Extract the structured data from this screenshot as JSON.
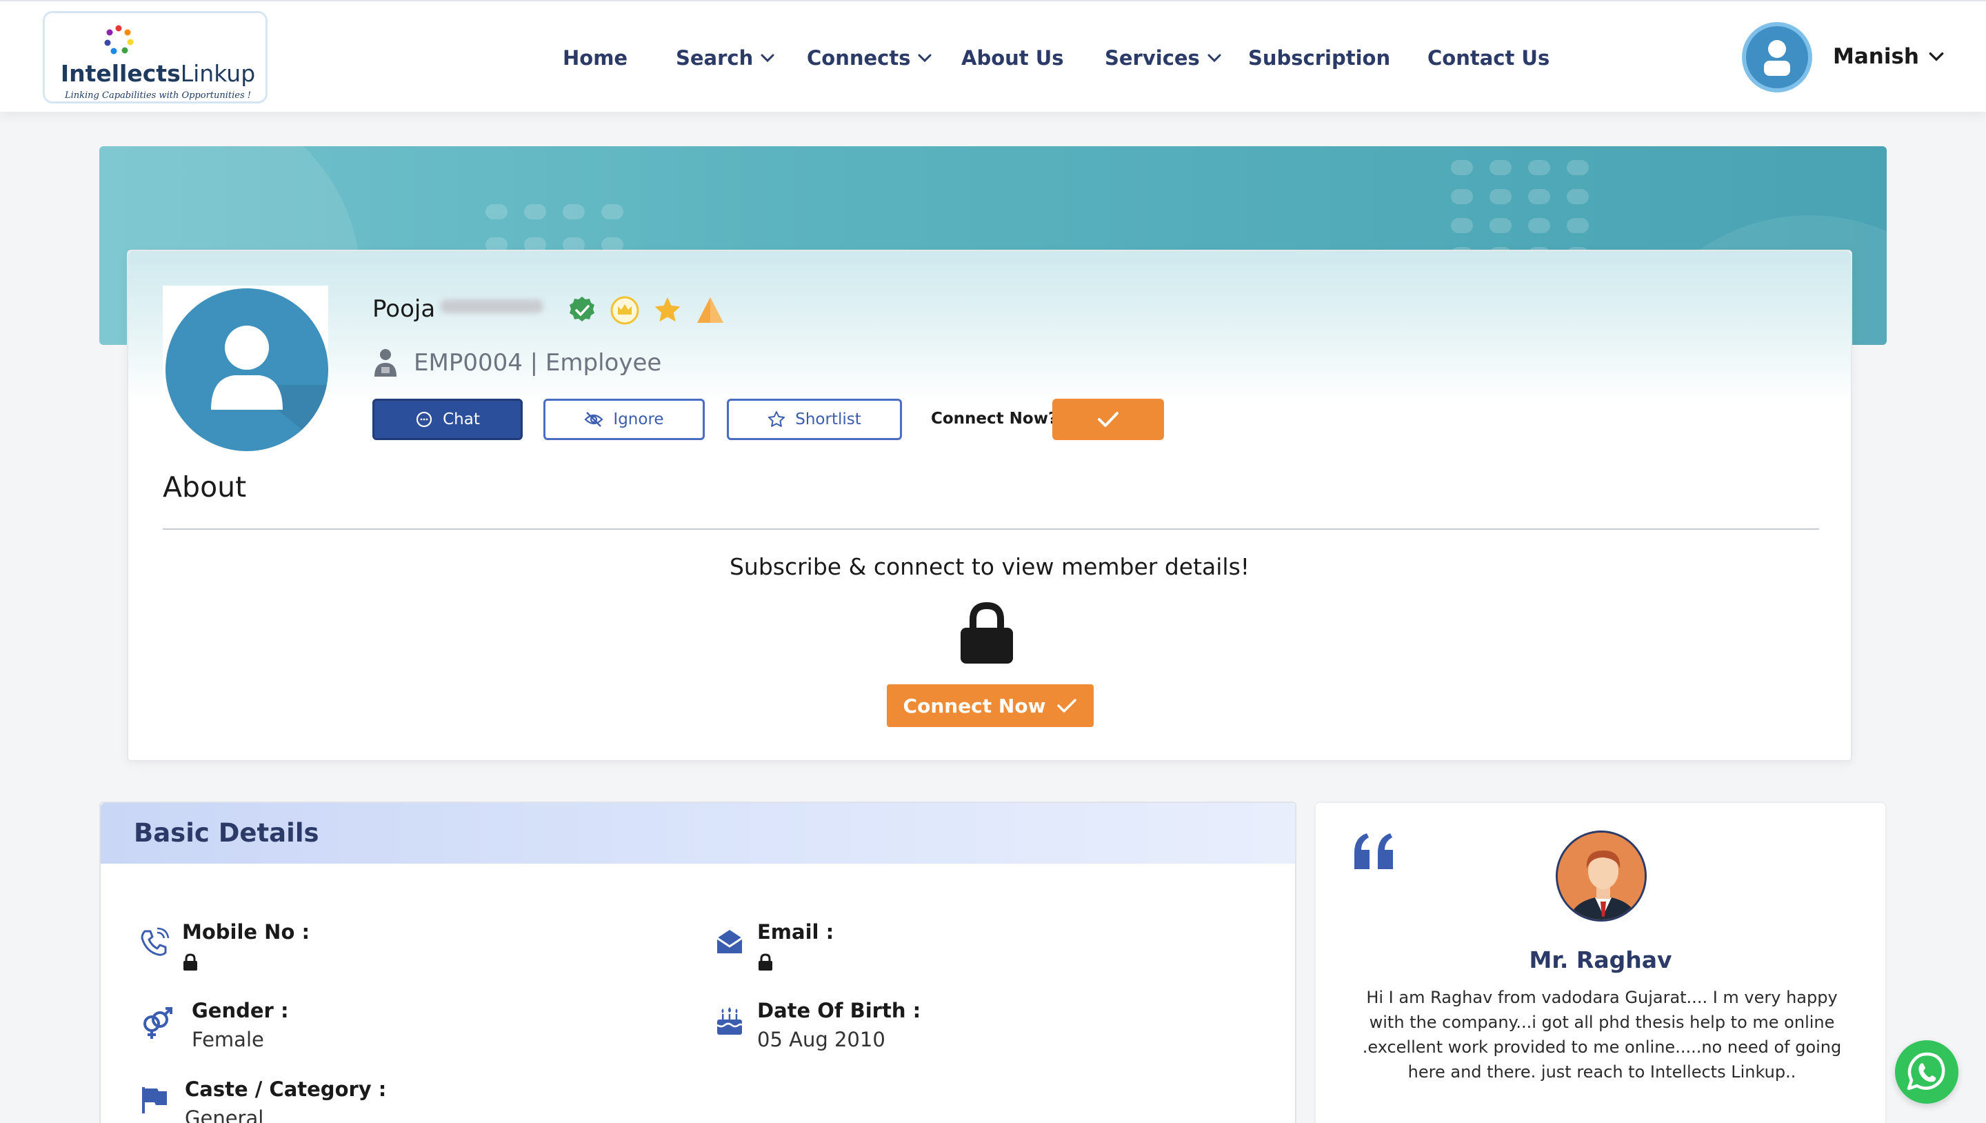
{
  "brand": {
    "name_bold": "Intellects",
    "name_regular": "Linkup",
    "tagline": "Linking Capabilities with Opportunities !"
  },
  "nav": {
    "items": [
      {
        "label": "Home",
        "dropdown": false
      },
      {
        "label": "Search",
        "dropdown": true
      },
      {
        "label": "Connects",
        "dropdown": true
      },
      {
        "label": "About Us",
        "dropdown": false
      },
      {
        "label": "Services",
        "dropdown": true
      },
      {
        "label": "Subscription",
        "dropdown": false
      },
      {
        "label": "Contact Us",
        "dropdown": false
      }
    ],
    "user_name": "Manish"
  },
  "profile": {
    "first_name": "Pooja",
    "badges": [
      "verified-icon",
      "crown-icon",
      "star-icon",
      "warning-icon"
    ],
    "employee_line": "EMP0004 | Employee",
    "actions": {
      "chat": "Chat",
      "ignore": "Ignore",
      "shortlist": "Shortlist",
      "connect_prompt": "Connect Now?"
    },
    "about_title": "About",
    "subscribe_message": "Subscribe & connect to view member details!",
    "connect_button": "Connect Now"
  },
  "basic_details": {
    "title": "Basic Details",
    "fields": {
      "mobile": {
        "label": "Mobile No :",
        "locked": true
      },
      "email": {
        "label": "Email :",
        "locked": true
      },
      "gender": {
        "label": "Gender :",
        "value": "Female"
      },
      "dob": {
        "label": "Date Of Birth :",
        "value": "05 Aug 2010"
      },
      "caste": {
        "label": "Caste / Category :",
        "value": "General"
      }
    }
  },
  "testimonial": {
    "name": "Mr. Raghav",
    "text": "Hi I am Raghav from vadodara Gujarat.... I m very happy with the company...i got all phd thesis help to me online .excellent work provided to me online.....no need of going here and there. just reach to Intellects Linkup.."
  },
  "colors": {
    "nav_text": "#2b3a67",
    "accent_orange": "#ef8b34",
    "chat_blue": "#2c4f9c",
    "banner_teal": "#5bb3bf",
    "whatsapp_green": "#32c45a"
  }
}
